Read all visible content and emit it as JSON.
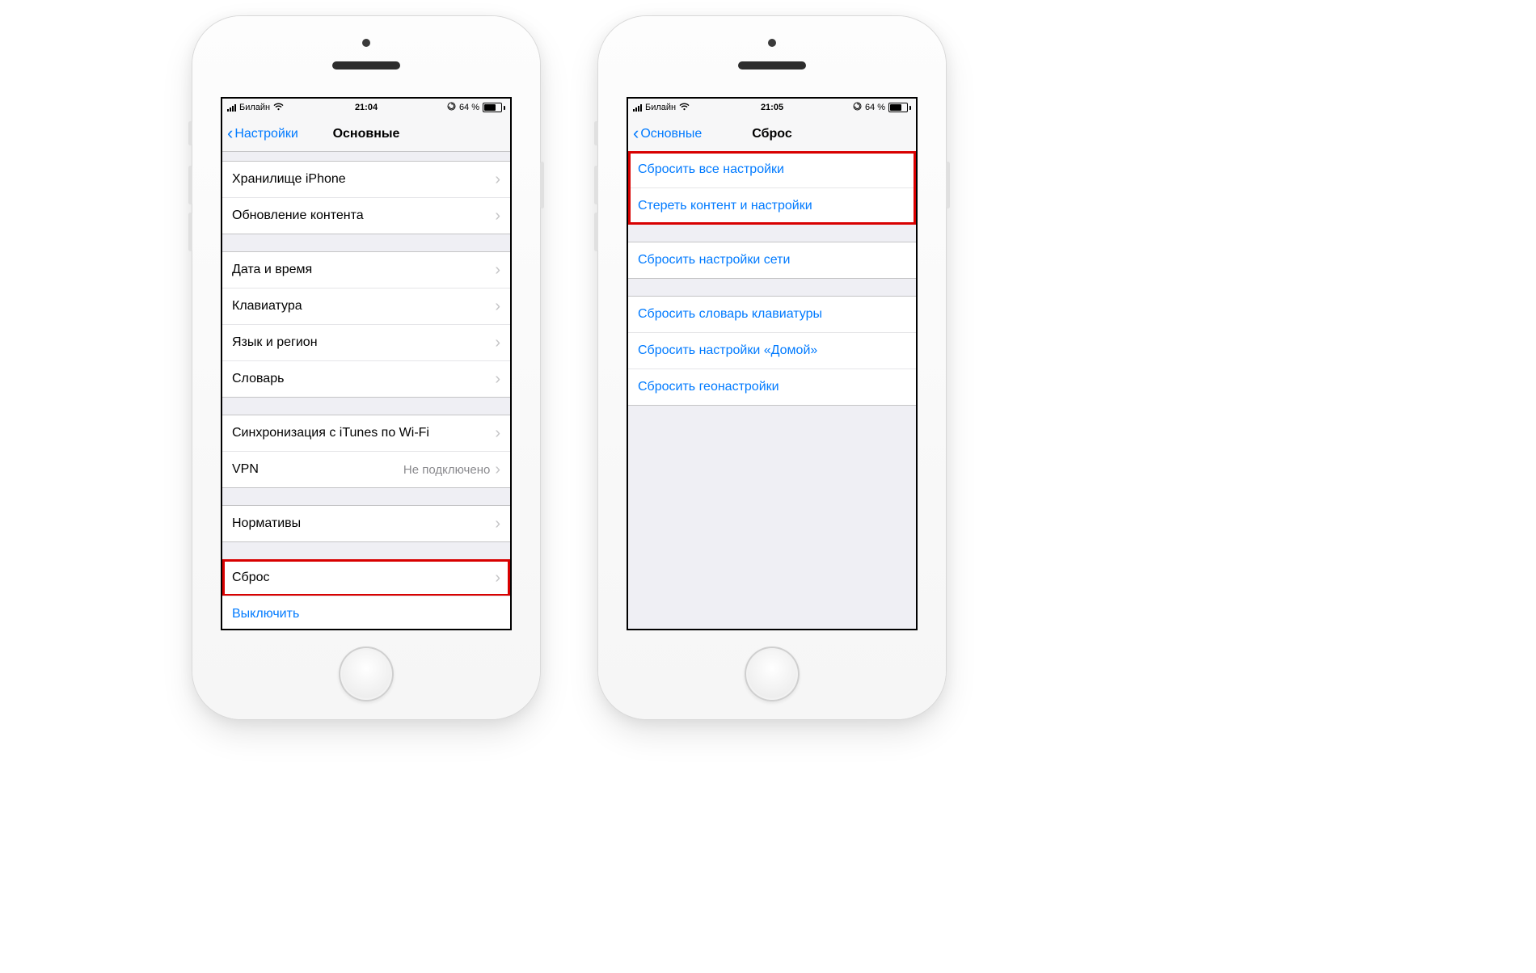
{
  "statusbar": {
    "carrier": "Билайн",
    "time_left": "21:04",
    "time_right": "21:05",
    "battery_text": "64 %",
    "rotation_lock": "⊖"
  },
  "left": {
    "back_label": "Настройки",
    "title": "Основные",
    "groups": [
      {
        "cells": [
          {
            "label": "Хранилище iPhone",
            "disclosure": true,
            "link": false
          },
          {
            "label": "Обновление контента",
            "disclosure": true,
            "link": false
          }
        ]
      },
      {
        "cells": [
          {
            "label": "Дата и время",
            "disclosure": true,
            "link": false
          },
          {
            "label": "Клавиатура",
            "disclosure": true,
            "link": false
          },
          {
            "label": "Язык и регион",
            "disclosure": true,
            "link": false
          },
          {
            "label": "Словарь",
            "disclosure": true,
            "link": false
          }
        ]
      },
      {
        "cells": [
          {
            "label": "Синхронизация с iTunes по Wi-Fi",
            "disclosure": true,
            "link": false
          },
          {
            "label": "VPN",
            "value": "Не подключено",
            "disclosure": true,
            "link": false
          }
        ]
      },
      {
        "cells": [
          {
            "label": "Нормативы",
            "disclosure": true,
            "link": false
          }
        ]
      },
      {
        "cells": [
          {
            "label": "Сброс",
            "disclosure": true,
            "link": false,
            "highlight": true
          },
          {
            "label": "Выключить",
            "disclosure": false,
            "link": true
          }
        ]
      }
    ]
  },
  "right": {
    "back_label": "Основные",
    "title": "Сброс",
    "groups": [
      {
        "highlight": true,
        "cells": [
          {
            "label": "Сбросить все настройки",
            "link": true
          },
          {
            "label": "Стереть контент и настройки",
            "link": true
          }
        ]
      },
      {
        "cells": [
          {
            "label": "Сбросить настройки сети",
            "link": true
          }
        ]
      },
      {
        "cells": [
          {
            "label": "Сбросить словарь клавиатуры",
            "link": true
          },
          {
            "label": "Сбросить настройки «Домой»",
            "link": true
          },
          {
            "label": "Сбросить геонастройки",
            "link": true
          }
        ]
      }
    ]
  }
}
